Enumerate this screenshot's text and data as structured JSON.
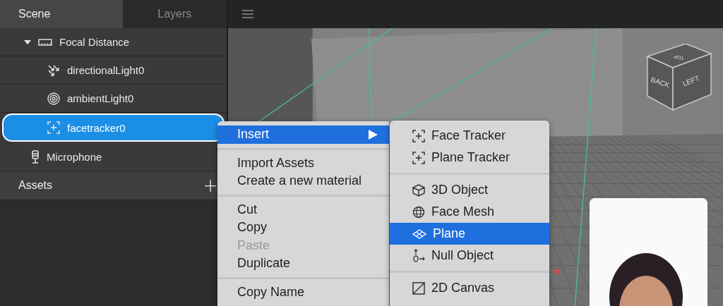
{
  "tabs": [
    {
      "label": "Scene",
      "selected": true
    },
    {
      "label": "Layers",
      "selected": false
    }
  ],
  "scene_tree": [
    {
      "label": "Focal Distance",
      "kind": "ruler",
      "selected": false,
      "expanded": true,
      "children": [
        {
          "label": "directionalLight0",
          "kind": "directional-light",
          "selected": false
        },
        {
          "label": "ambientLight0",
          "kind": "ambient-light",
          "selected": false
        },
        {
          "label": "facetracker0",
          "kind": "tracker",
          "selected": true
        }
      ]
    },
    {
      "label": "Microphone",
      "kind": "microphone",
      "selected": false
    }
  ],
  "assets_panel": {
    "title": "Assets",
    "add_button": "+"
  },
  "viewport": {
    "view_cube": {
      "top": "TOP",
      "front": "BACK",
      "side": "LEFT"
    }
  },
  "context_menu": {
    "groups": [
      [
        {
          "label": "Insert",
          "submenu": true,
          "selected": true,
          "disabled": false
        }
      ],
      [
        {
          "label": "Import Assets",
          "submenu": false,
          "selected": false,
          "disabled": false
        },
        {
          "label": "Create a new material",
          "submenu": false,
          "selected": false,
          "disabled": false
        }
      ],
      [
        {
          "label": "Cut",
          "submenu": false,
          "selected": false,
          "disabled": false
        },
        {
          "label": "Copy",
          "submenu": false,
          "selected": false,
          "disabled": false
        },
        {
          "label": "Paste",
          "submenu": false,
          "selected": false,
          "disabled": true
        },
        {
          "label": "Duplicate",
          "submenu": false,
          "selected": false,
          "disabled": false
        }
      ],
      [
        {
          "label": "Copy Name",
          "submenu": false,
          "selected": false,
          "disabled": false
        }
      ]
    ]
  },
  "submenu": {
    "groups": [
      [
        {
          "label": "Face Tracker",
          "kind": "tracker",
          "selected": false
        },
        {
          "label": "Plane Tracker",
          "kind": "tracker",
          "selected": false
        }
      ],
      [
        {
          "label": "3D Object",
          "kind": "cube",
          "selected": false
        },
        {
          "label": "Face Mesh",
          "kind": "globe",
          "selected": false
        },
        {
          "label": "Plane",
          "kind": "plane",
          "selected": true
        },
        {
          "label": "Null Object",
          "kind": "null",
          "selected": false
        }
      ],
      [
        {
          "label": "2D Canvas",
          "kind": "canvas",
          "selected": false
        }
      ]
    ]
  }
}
